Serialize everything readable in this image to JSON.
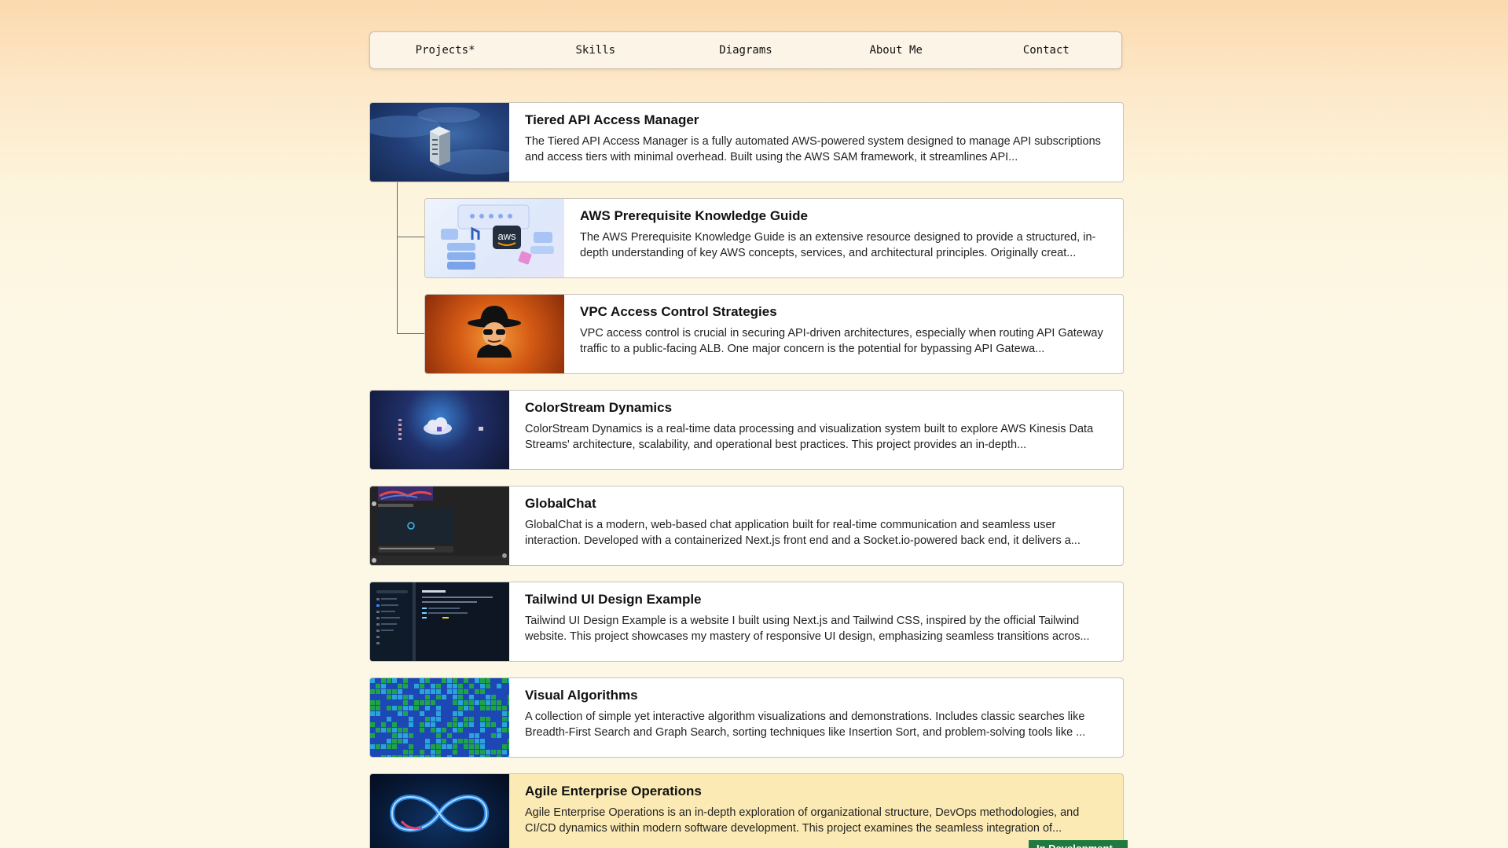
{
  "nav": {
    "items": [
      "Projects*",
      "Skills",
      "Diagrams",
      "About Me",
      "Contact"
    ]
  },
  "projects": [
    {
      "title": "Tiered API Access Manager",
      "desc": "The Tiered API Access Manager is a fully automated AWS-powered system designed to manage API subscriptions and access tiers with minimal overhead. Built using the AWS SAM framework, it streamlines API...",
      "thumb_icon": "server-icon"
    },
    {
      "title": "AWS Prerequisite Knowledge Guide",
      "desc": "The AWS Prerequisite Knowledge Guide is an extensive resource designed to provide a structured, in-depth understanding of key AWS concepts, services, and architectural principles. Originally creat...",
      "thumb_icon": "aws-illustration-icon",
      "thumb_text": "aws"
    },
    {
      "title": "VPC Access Control Strategies",
      "desc": "VPC access control is crucial in securing API-driven architectures, especially when routing API Gateway traffic to a public-facing ALB. One major concern is the potential for bypassing API Gatewa...",
      "thumb_icon": "spy-icon"
    },
    {
      "title": "ColorStream Dynamics",
      "desc": "ColorStream Dynamics is a real-time data processing and visualization system built to explore AWS Kinesis Data Streams' architecture, scalability, and operational best practices. This project provides an in-depth...",
      "thumb_icon": "cloud-stream-icon"
    },
    {
      "title": "GlobalChat",
      "desc": "GlobalChat is a modern, web-based chat application built for real-time communication and seamless user interaction. Developed with a containerized Next.js front end and a Socket.io-powered back end, it delivers a...",
      "thumb_icon": "chat-app-screenshot-icon"
    },
    {
      "title": "Tailwind UI Design Example",
      "desc": "Tailwind UI Design Example is a website I built using Next.js and Tailwind CSS, inspired by the official Tailwind website. This project showcases my mastery of responsive UI design, emphasizing seamless transitions acros...",
      "thumb_icon": "tailwind-screenshot-icon"
    },
    {
      "title": "Visual Algorithms",
      "desc": "A collection of simple yet interactive algorithm visualizations and demonstrations. Includes classic searches like Breadth-First Search and Graph Search, sorting techniques like Insertion Sort, and problem-solving tools like ...",
      "thumb_icon": "grid-map-icon"
    },
    {
      "title": "Agile Enterprise Operations",
      "desc": "Agile Enterprise Operations is an in-depth exploration of organizational structure, DevOps methodologies, and CI/CD dynamics within modern software development. This project examines the seamless integration of...",
      "thumb_icon": "infinity-icon",
      "badge": "In Development"
    }
  ],
  "colors": {
    "dev_card_bg": "#fbeab4",
    "badge_bg": "#1f7a3e"
  }
}
